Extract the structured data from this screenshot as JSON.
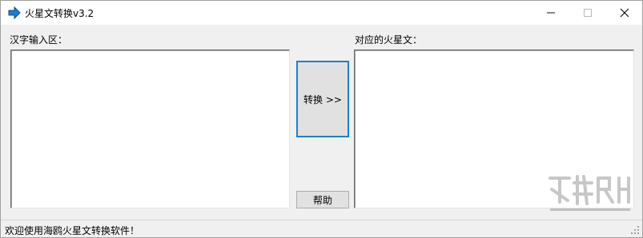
{
  "window": {
    "title": "火星文转换v3.2"
  },
  "window_controls": {
    "minimize_icon": "minimize-icon",
    "maximize_icon": "maximize-icon",
    "close_icon": "close-icon"
  },
  "input_panel": {
    "label": "汉字输入区：",
    "value": ""
  },
  "output_panel": {
    "label": "对应的火星文：",
    "value": ""
  },
  "buttons": {
    "convert_label": "转换 >>",
    "help_label": "帮助"
  },
  "status": {
    "text": "欢迎使用海鸥火星文转换软件！"
  },
  "colors": {
    "app_icon": "#1a7fd4",
    "focus_border": "#1e7fd0",
    "background": "#f0f0f0"
  }
}
